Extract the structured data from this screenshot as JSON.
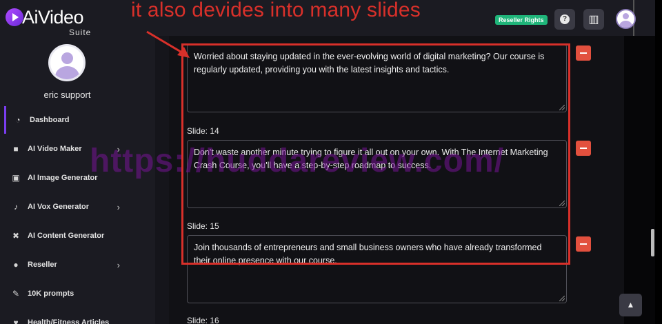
{
  "brand": {
    "name": "AiVideo",
    "sub": "Suite"
  },
  "profile": {
    "name": "eric support"
  },
  "sidebar": {
    "items": [
      {
        "label": "Dashboard",
        "icon": "speedometer-icon",
        "glyph": "◔",
        "active": true,
        "chevron": ""
      },
      {
        "label": "AI Video Maker",
        "icon": "video-camera-icon",
        "glyph": "■",
        "active": false,
        "chevron": "›"
      },
      {
        "label": "AI Image Generator",
        "icon": "image-icon",
        "glyph": "▣",
        "active": false,
        "chevron": ""
      },
      {
        "label": "AI Vox Generator",
        "icon": "microphone-icon",
        "glyph": "♪",
        "active": false,
        "chevron": "›"
      },
      {
        "label": "AI Content Generator",
        "icon": "tools-icon",
        "glyph": "✖",
        "active": false,
        "chevron": ""
      },
      {
        "label": "Reseller",
        "icon": "users-icon",
        "glyph": "●",
        "active": false,
        "chevron": "›"
      },
      {
        "label": "10K prompts",
        "icon": "pen-icon",
        "glyph": "✎",
        "active": false,
        "chevron": ""
      },
      {
        "label": "Health/Fitness Articles",
        "icon": "heart-icon",
        "glyph": "♥",
        "active": false,
        "chevron": ""
      }
    ]
  },
  "header": {
    "reseller_badge": "Reseller Rights",
    "help_glyph": "?",
    "buildings_glyph": "▥"
  },
  "slides": {
    "first_text": "Worried about staying updated in the ever-evolving world of digital marketing? Our course is regularly updated, providing you with the latest insights and tactics.",
    "slide14_label": "Slide: 14",
    "slide14_text": "Don't waste another minute trying to figure it all out on your own. With The Internet Marketing Crash Course, you'll have a step-by-step roadmap to success.",
    "slide15_label": "Slide: 15",
    "slide15_text": "Join thousands of entrepreneurs and small business owners who have already transformed their online presence with our course.",
    "slide16_label": "Slide: 16"
  },
  "scroll_top_glyph": "▲",
  "annotation": {
    "text": "it also devides into many slides",
    "color": "#d8302a"
  },
  "watermark": "https://huddareview.com/"
}
